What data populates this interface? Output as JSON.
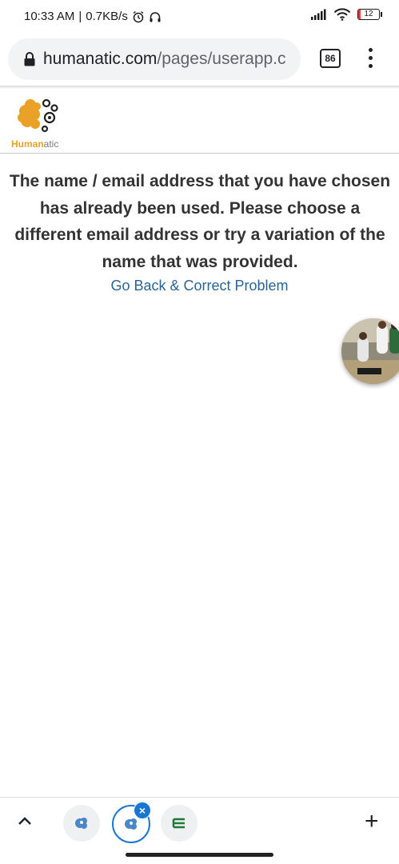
{
  "status_bar": {
    "time": "10:33 AM",
    "separator": "|",
    "net_speed": "0.7KB/s",
    "battery": "12",
    "battery_level": 0.12,
    "battery_color": "#e53935",
    "icons": [
      "alarm-icon",
      "headphones-icon",
      "signal-icon",
      "wifi-icon",
      "battery-icon"
    ]
  },
  "browser": {
    "url_domain": "humanatic.com",
    "url_path": "/pages/userapp.c",
    "tab_count": "86"
  },
  "site": {
    "logo_text_a": "Human",
    "logo_text_b": "atic",
    "brand_color": "#e9a227"
  },
  "main": {
    "error_message": "The name / email address that you have chosen has already been used. Please choose a different email address or try a variation of the name that was provided.",
    "link_label": "Go Back & Correct Problem",
    "link_color": "#2a6496"
  },
  "bottom_bar": {
    "close_icon": "×",
    "new_tab_label": "+",
    "accent_color": "#1976d2"
  }
}
